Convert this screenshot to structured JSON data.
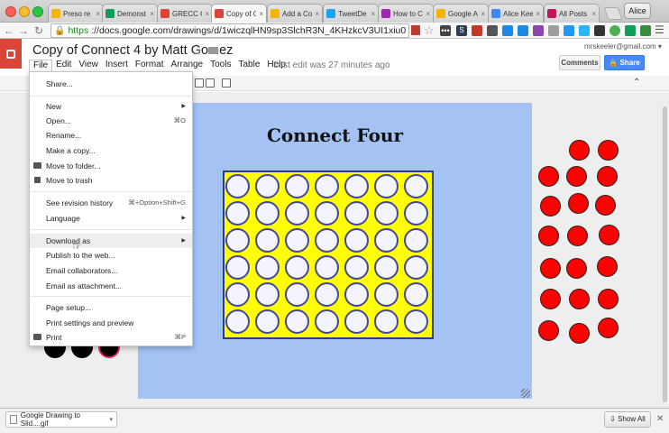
{
  "browser": {
    "tabs": [
      {
        "label": "Preso re",
        "icon": "slides-icon",
        "color": "#f4b400"
      },
      {
        "label": "Demonst",
        "icon": "sheets-icon",
        "color": "#0f9d58"
      },
      {
        "label": "GRECC C",
        "icon": "drawing-icon",
        "color": "#db4437"
      },
      {
        "label": "Copy of C",
        "icon": "drawing-icon",
        "color": "#db4437"
      },
      {
        "label": "Add a Co",
        "icon": "slides-icon",
        "color": "#f4b400"
      },
      {
        "label": "TweetDe",
        "icon": "twitter-icon",
        "color": "#1da1f2"
      },
      {
        "label": "How to C",
        "icon": "web-icon",
        "color": "#9c27b0"
      },
      {
        "label": "Google A",
        "icon": "slides-icon",
        "color": "#f4b400"
      },
      {
        "label": "Alice Kee",
        "icon": "docs-icon",
        "color": "#4285f4"
      },
      {
        "label": "All Posts",
        "icon": "web-icon",
        "color": "#c2185b"
      }
    ],
    "user": "Alice",
    "url_scheme": "https",
    "url_rest": "://docs.google.com/drawings/d/1wiczqlHN9sp3SlchR3N_4KHzkcV3UI1xiu0oj..."
  },
  "doc": {
    "title": "Copy of Connect 4 by Matt Gomez",
    "menu": [
      "File",
      "Edit",
      "View",
      "Insert",
      "Format",
      "Arrange",
      "Tools",
      "Table",
      "Help"
    ],
    "last_edit": "Last edit was 27 minutes ago",
    "user_email": "mrskeeler@gmail.com ▾",
    "comments": "Comments",
    "share": "Share"
  },
  "file_menu": {
    "share": "Share...",
    "new": "New",
    "open": "Open...",
    "open_sc": "⌘O",
    "rename": "Rename...",
    "make_copy": "Make a copy...",
    "move_folder": "Move to folder...",
    "move_trash": "Move to trash",
    "revision": "See revision history",
    "revision_sc": "⌘+Option+Shift+G",
    "language": "Language",
    "download": "Download as",
    "publish": "Publish to the web...",
    "email_collab": "Email collaborators...",
    "email_attach": "Email as attachment...",
    "page_setup": "Page setup...",
    "print_settings": "Print settings and preview",
    "print": "Print",
    "print_sc": "⌘P"
  },
  "drawing": {
    "title": "Connect Four",
    "board_rows": 6,
    "board_cols": 7,
    "board_color": "#ffff00",
    "page_color": "#a4c2f4",
    "piece_color": "#ff0000",
    "red_pieces_count": 20
  },
  "download_bar": {
    "file": "Google Drawing to Slid....gif",
    "show_all": "Show All"
  }
}
